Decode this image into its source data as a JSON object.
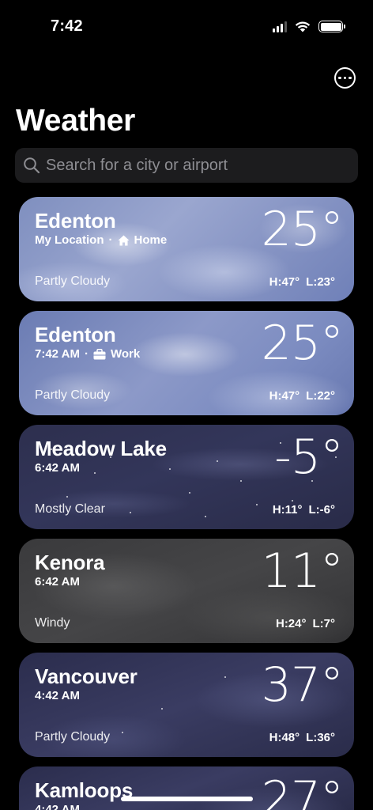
{
  "status_bar": {
    "time": "7:42"
  },
  "header": {
    "title": "Weather"
  },
  "search": {
    "placeholder": "Search for a city or airport"
  },
  "locations": [
    {
      "city": "Edenton",
      "subtitle": "My Location",
      "tag": "Home",
      "tag_icon": "house-icon",
      "temp": "25°",
      "condition": "Partly Cloudy",
      "high": "H:47°",
      "low": "L:23°"
    },
    {
      "city": "Edenton",
      "subtitle": "7:42 AM",
      "tag": "Work",
      "tag_icon": "briefcase-icon",
      "temp": "25°",
      "condition": "Partly Cloudy",
      "high": "H:47°",
      "low": "L:22°"
    },
    {
      "city": "Meadow Lake",
      "subtitle": "6:42 AM",
      "temp": "-5°",
      "condition": "Mostly Clear",
      "high": "H:11°",
      "low": "L:-6°"
    },
    {
      "city": "Kenora",
      "subtitle": "6:42 AM",
      "temp": "11°",
      "condition": "Windy",
      "high": "H:24°",
      "low": "L:7°"
    },
    {
      "city": "Vancouver",
      "subtitle": "4:42 AM",
      "temp": "37°",
      "condition": "Partly Cloudy",
      "high": "H:48°",
      "low": "L:36°"
    },
    {
      "city": "Kamloops",
      "subtitle": "4:42 AM",
      "temp": "27°"
    }
  ]
}
